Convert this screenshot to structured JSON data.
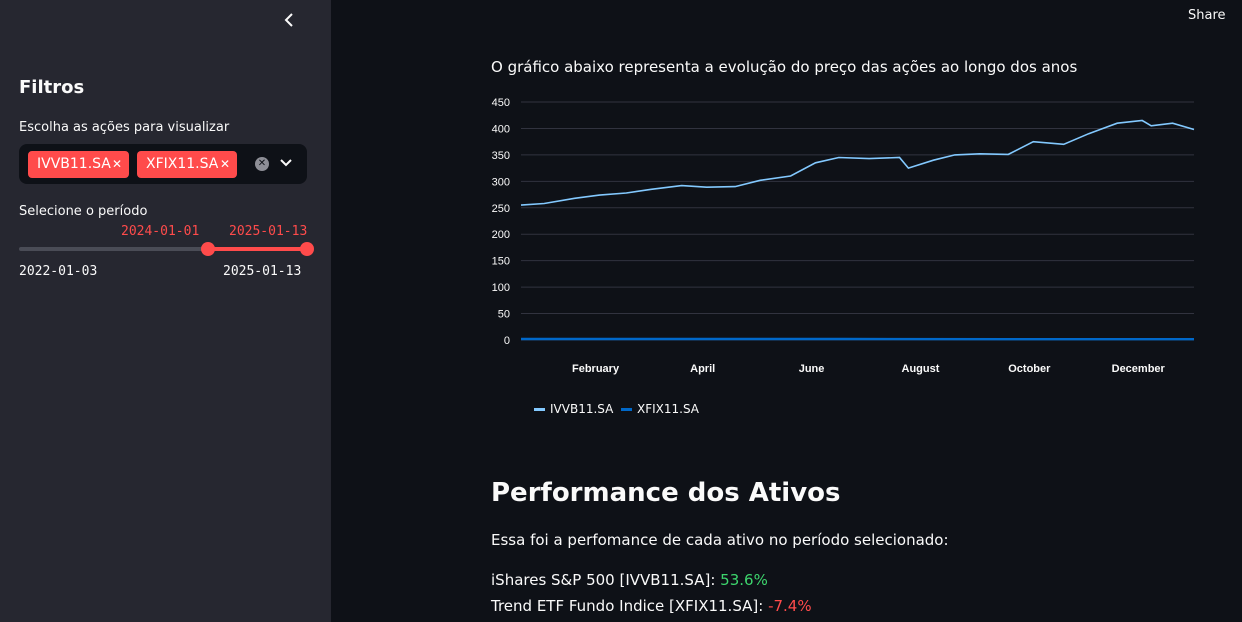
{
  "header": {
    "share_label": "Share"
  },
  "sidebar": {
    "collapse_icon": "chevron-left-icon",
    "title": "Filtros",
    "stocks_label": "Escolha as ações para visualizar",
    "selected_tags": [
      "IVVB11.SA",
      "XFIX11.SA"
    ],
    "period_label": "Selecione o período",
    "slider": {
      "min_label": "2022-01-03",
      "max_label": "2025-01-13",
      "start_value": "2024-01-01",
      "end_value": "2025-01-13",
      "start_fraction": 0.655,
      "end_fraction": 1.0
    }
  },
  "main": {
    "chart_caption": "O gráfico abaixo representa a evolução do preço das ações ao longo dos anos",
    "section_title": "Performance dos Ativos",
    "section_desc": "Essa foi a perfomance de cada ativo no período selecionado:",
    "performance": [
      {
        "label": "iShares S&P 500 [IVVB11.SA]:",
        "value": "53.6%",
        "status": "pos"
      },
      {
        "label": "Trend ETF Fundo Indice [XFIX11.SA]:",
        "value": "-7.4%",
        "status": "neg"
      }
    ]
  },
  "colors": {
    "accent": "#ff4b4b",
    "positive": "#3dd56d",
    "ivvb": "#83c9ff",
    "xfix": "#0068c9"
  },
  "chart_data": {
    "type": "line",
    "yticks": [
      0,
      50,
      100,
      150,
      200,
      250,
      300,
      350,
      400,
      450
    ],
    "ylim": [
      0,
      450
    ],
    "xticks": [
      "February",
      "April",
      "June",
      "August",
      "October",
      "December"
    ],
    "xlim": [
      "2024-01-02",
      "2025-01-13"
    ],
    "series": [
      {
        "name": "IVVB11.SA",
        "color": "#83c9ff",
        "x": [
          "2024-01-02",
          "2024-01-15",
          "2024-02-01",
          "2024-02-15",
          "2024-03-01",
          "2024-03-15",
          "2024-04-01",
          "2024-04-15",
          "2024-05-01",
          "2024-05-15",
          "2024-06-01",
          "2024-06-15",
          "2024-06-28",
          "2024-07-15",
          "2024-08-01",
          "2024-08-06",
          "2024-08-20",
          "2024-09-01",
          "2024-09-15",
          "2024-10-01",
          "2024-10-15",
          "2024-11-01",
          "2024-11-15",
          "2024-12-01",
          "2024-12-15",
          "2024-12-20",
          "2025-01-01",
          "2025-01-13"
        ],
        "values": [
          255,
          258,
          268,
          274,
          278,
          285,
          292,
          289,
          290,
          302,
          310,
          335,
          345,
          343,
          345,
          325,
          340,
          350,
          352,
          351,
          375,
          370,
          390,
          410,
          415,
          405,
          410,
          398
        ]
      },
      {
        "name": "XFIX11.SA",
        "color": "#0068c9",
        "x": [
          "2024-01-02",
          "2024-04-01",
          "2024-07-01",
          "2024-10-01",
          "2025-01-13"
        ],
        "values": [
          1.8,
          1.9,
          1.8,
          1.5,
          1.6
        ]
      }
    ]
  }
}
